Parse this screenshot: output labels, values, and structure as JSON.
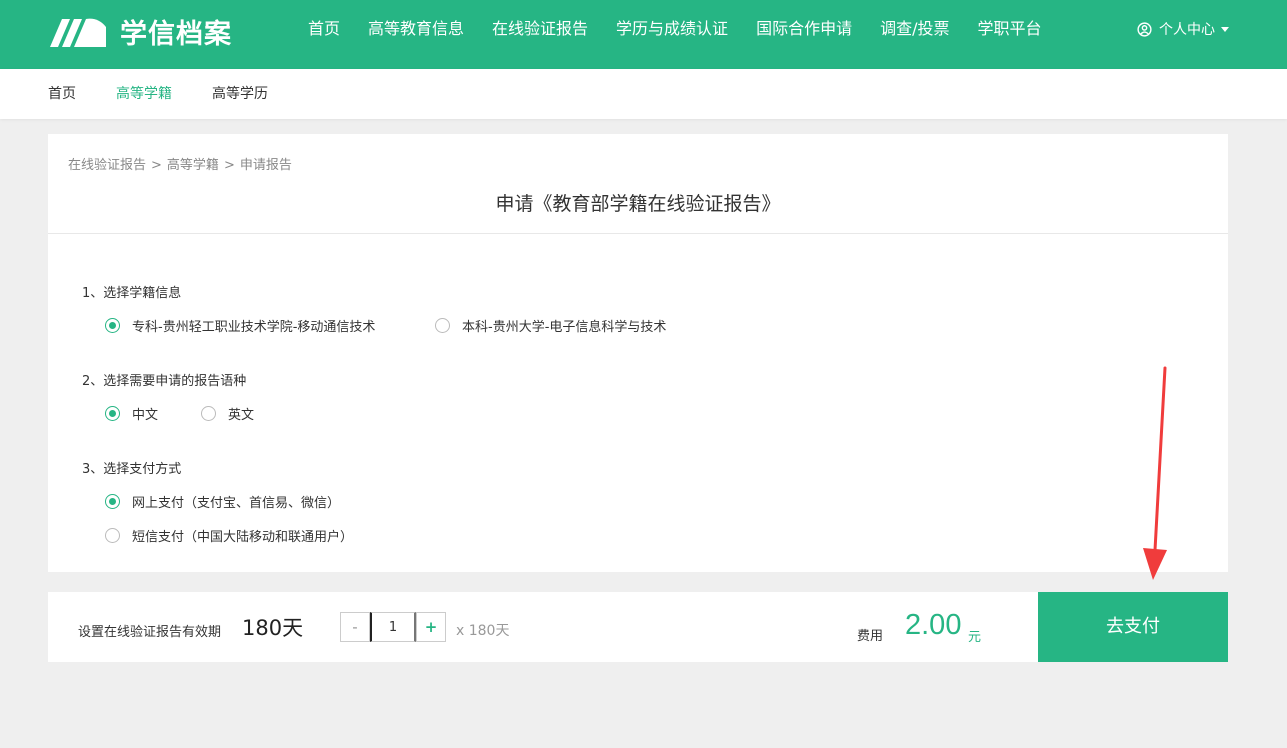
{
  "header": {
    "logo_text": "学信档案",
    "nav": [
      "首页",
      "高等教育信息",
      "在线验证报告",
      "学历与成绩认证",
      "国际合作申请",
      "调查/投票",
      "学职平台"
    ],
    "active_nav": "在线验证报告",
    "user_center": "个人中心"
  },
  "subnav": {
    "items": [
      "首页",
      "高等学籍",
      "高等学历"
    ],
    "active": "高等学籍"
  },
  "breadcrumb": [
    "在线验证报告",
    "高等学籍",
    "申请报告"
  ],
  "breadcrumb_sep": ">",
  "page_title": "申请《教育部学籍在线验证报告》",
  "sections": [
    {
      "title": "1、选择学籍信息",
      "options": [
        {
          "label": "专科-贵州轻工职业技术学院-移动通信技术",
          "checked": true
        },
        {
          "label": "本科-贵州大学-电子信息科学与技术",
          "checked": false
        }
      ]
    },
    {
      "title": "2、选择需要申请的报告语种",
      "options": [
        {
          "label": "中文",
          "checked": true
        },
        {
          "label": "英文",
          "checked": false
        }
      ]
    },
    {
      "title": "3、选择支付方式",
      "options": [
        {
          "label": "网上支付（支付宝、首信易、微信）",
          "checked": true
        },
        {
          "label": "短信支付（中国大陆移动和联通用户）",
          "checked": false
        }
      ]
    }
  ],
  "bottom": {
    "validity_label": "设置在线验证报告有效期",
    "validity_value": "180天",
    "stepper_minus": "-",
    "stepper_plus": "+",
    "quantity": "1",
    "multiplier": "x 180天",
    "fee_label": "费用",
    "fee_amount": "2.00",
    "fee_unit": "元",
    "pay_button": "去支付"
  },
  "colors": {
    "brand": "#26b584",
    "annotation_arrow": "#f03c3c"
  },
  "icons": [
    "logo-mark",
    "user-circle-icon",
    "caret-down-icon",
    "annotation-arrow"
  ]
}
